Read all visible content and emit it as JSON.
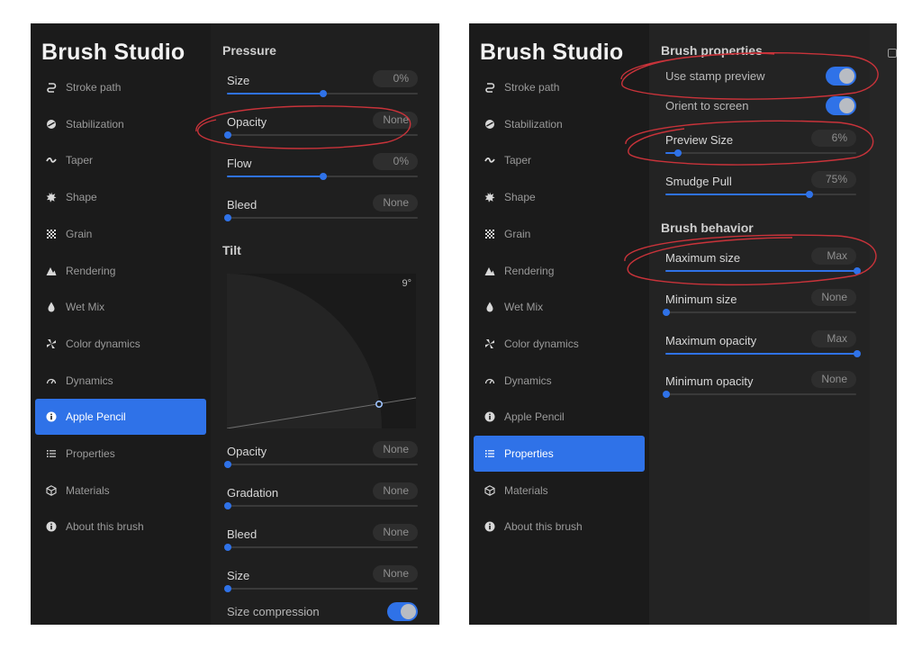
{
  "left_panel": {
    "app_title": "Brush Studio",
    "sidebar": [
      {
        "label": "Stroke path",
        "icon": "stroke-path-icon"
      },
      {
        "label": "Stabilization",
        "icon": "stabilization-icon"
      },
      {
        "label": "Taper",
        "icon": "taper-icon"
      },
      {
        "label": "Shape",
        "icon": "shape-icon"
      },
      {
        "label": "Grain",
        "icon": "grain-icon"
      },
      {
        "label": "Rendering",
        "icon": "rendering-icon"
      },
      {
        "label": "Wet Mix",
        "icon": "wet-mix-icon"
      },
      {
        "label": "Color dynamics",
        "icon": "color-dynamics-icon"
      },
      {
        "label": "Dynamics",
        "icon": "dynamics-icon"
      },
      {
        "label": "Apple Pencil",
        "icon": "apple-pencil-icon"
      },
      {
        "label": "Properties",
        "icon": "properties-icon"
      },
      {
        "label": "Materials",
        "icon": "materials-icon"
      },
      {
        "label": "About this brush",
        "icon": "info-icon"
      }
    ],
    "active_index": 9,
    "pressure": {
      "heading": "Pressure",
      "rows": [
        {
          "label": "Size",
          "value": "0%",
          "level": 0.5
        },
        {
          "label": "Opacity",
          "value": "None",
          "level": 0.0
        },
        {
          "label": "Flow",
          "value": "0%",
          "level": 0.5
        },
        {
          "label": "Bleed",
          "value": "None",
          "level": 0.0
        }
      ]
    },
    "tilt": {
      "heading": "Tilt",
      "angle_readout": "9°",
      "rows": [
        {
          "label": "Opacity",
          "value": "None",
          "level": 0.0
        },
        {
          "label": "Gradation",
          "value": "None",
          "level": 0.0
        },
        {
          "label": "Bleed",
          "value": "None",
          "level": 0.0
        },
        {
          "label": "Size",
          "value": "None",
          "level": 0.0
        }
      ],
      "toggle": {
        "label": "Size compression",
        "on": true
      }
    }
  },
  "right_panel": {
    "app_title": "Brush Studio",
    "active_index": 10,
    "brush_properties": {
      "heading": "Brush properties",
      "toggles": [
        {
          "label": "Use stamp preview",
          "on": true
        },
        {
          "label": "Orient to screen",
          "on": true
        }
      ],
      "rows": [
        {
          "label": "Preview Size",
          "value": "6%",
          "level": 0.06
        },
        {
          "label": "Smudge Pull",
          "value": "75%",
          "level": 0.75
        }
      ]
    },
    "brush_behavior": {
      "heading": "Brush behavior",
      "rows": [
        {
          "label": "Maximum size",
          "value": "Max",
          "level": 1.0
        },
        {
          "label": "Minimum size",
          "value": "None",
          "level": 0.0
        },
        {
          "label": "Maximum opacity",
          "value": "Max",
          "level": 1.0
        },
        {
          "label": "Minimum opacity",
          "value": "None",
          "level": 0.0
        }
      ]
    }
  },
  "colors": {
    "accent": "#2f72e8",
    "annotation": "#c9333a"
  }
}
